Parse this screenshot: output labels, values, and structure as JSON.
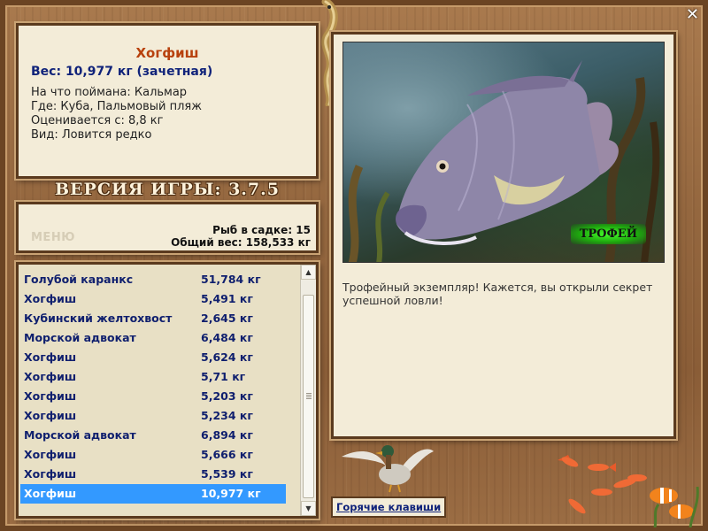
{
  "window": {
    "close_glyph": "✕"
  },
  "fish_info": {
    "name": "Хогфиш",
    "weight_line": "Вес: 10,977 кг (зачетная)",
    "bait": "На что поймана: Кальмар",
    "location": "Где: Куба, Пальмовый пляж",
    "score": "Оценивается с: 8,8 кг",
    "rarity": "Вид: Ловится редко"
  },
  "version": "ВЕРСИЯ ИГРЫ: 3.7.5",
  "status": {
    "menu_label": "МЕНЮ",
    "cage_count": "Рыб в садке: 15",
    "total_weight": "Общий вес: 158,533 кг"
  },
  "catch_list": [
    {
      "name": "Голубой каранкс",
      "weight": "51,784 кг",
      "selected": false
    },
    {
      "name": "Хогфиш",
      "weight": "5,491 кг",
      "selected": false
    },
    {
      "name": "Кубинский желтохвост",
      "weight": "2,645 кг",
      "selected": false
    },
    {
      "name": "Морской адвокат",
      "weight": "6,484 кг",
      "selected": false
    },
    {
      "name": "Хогфиш",
      "weight": "5,624 кг",
      "selected": false
    },
    {
      "name": "Хогфиш",
      "weight": "5,71 кг",
      "selected": false
    },
    {
      "name": "Хогфиш",
      "weight": "5,203 кг",
      "selected": false
    },
    {
      "name": "Хогфиш",
      "weight": "5,234 кг",
      "selected": false
    },
    {
      "name": "Морской адвокат",
      "weight": "6,894 кг",
      "selected": false
    },
    {
      "name": "Хогфиш",
      "weight": "5,666 кг",
      "selected": false
    },
    {
      "name": "Хогфиш",
      "weight": "5,539 кг",
      "selected": false
    },
    {
      "name": "Хогфиш",
      "weight": "10,977 кг",
      "selected": true
    }
  ],
  "scrollbar": {
    "up_glyph": "▲",
    "down_glyph": "▼"
  },
  "detail": {
    "trophy_badge": "ТРОФЕЙ",
    "description": "Трофейный экземпляр! Кажется, вы открыли секрет успешной ловли!"
  },
  "hotkeys_label": "Горячие клавиши",
  "colors": {
    "accent_name": "#b8410d",
    "list_text": "#0f1f6e",
    "selection": "#3399ff",
    "trophy_green": "#46ff2a",
    "wood": "#94673f"
  },
  "icons": [
    "close-icon",
    "fish-photo",
    "eel-decoration",
    "duck-decoration",
    "fish-decoration"
  ]
}
